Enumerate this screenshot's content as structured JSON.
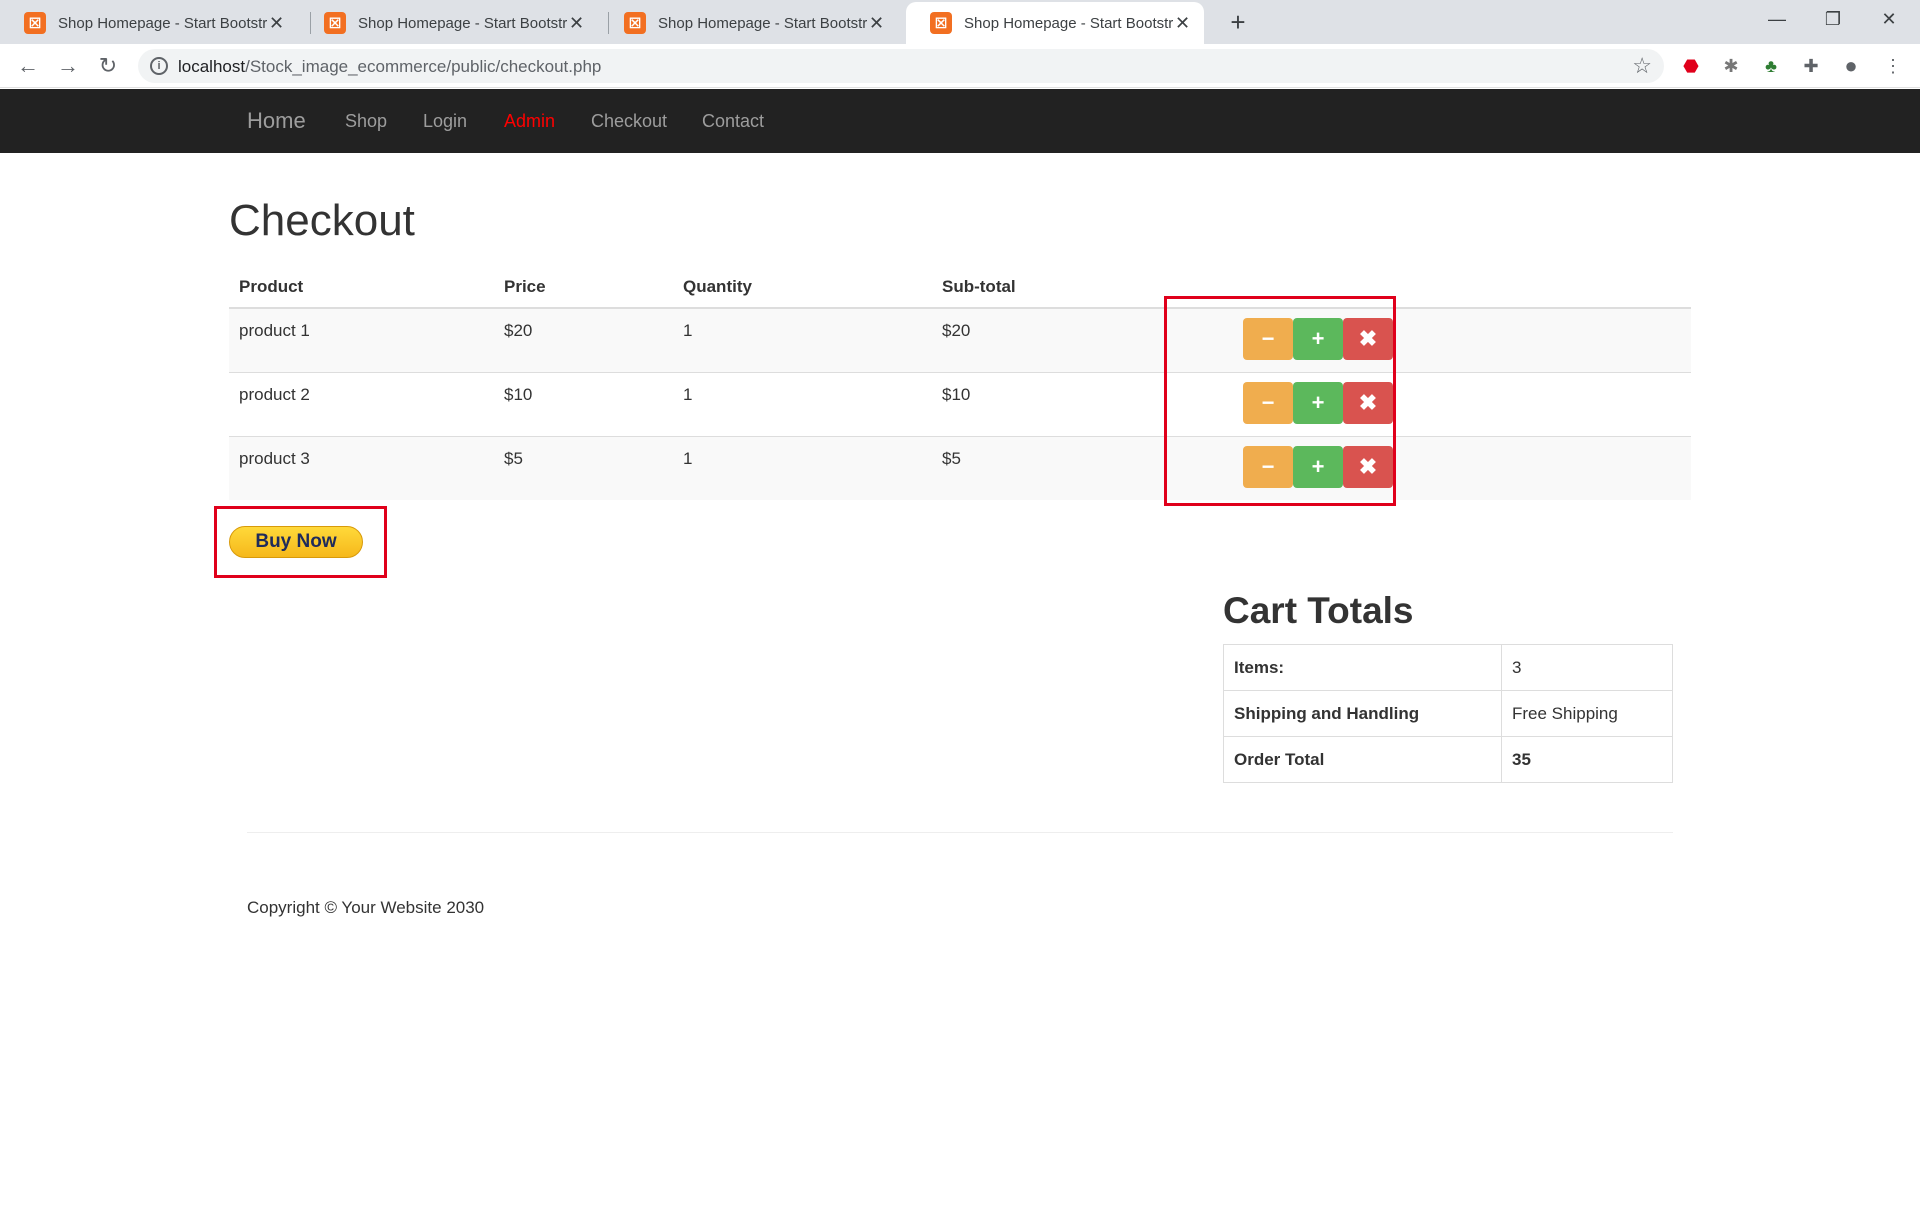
{
  "browser": {
    "tabs": [
      {
        "title": "Shop Homepage - Start Bootstrap",
        "active": false,
        "favicon": "xampp-icon"
      },
      {
        "title": "Shop Homepage - Start Bootstrap",
        "active": false,
        "favicon": "xampp-icon"
      },
      {
        "title": "Shop Homepage - Start Bootstrap",
        "active": false,
        "favicon": "xampp-icon"
      },
      {
        "title": "Shop Homepage - Start Bootstrap",
        "active": true,
        "favicon": "xampp-icon"
      }
    ],
    "url_host": "localhost",
    "url_path": "/Stock_image_ecommerce/public/checkout.php",
    "extensions": [
      "adblock-icon",
      "bug-icon",
      "tree-icon",
      "puzzle-icon",
      "profile-icon",
      "menu-icon"
    ]
  },
  "navbar": {
    "brand": "Home",
    "links": [
      "Shop",
      "Login",
      "Admin",
      "Checkout",
      "Contact"
    ],
    "admin_color": "#ff0000"
  },
  "checkout": {
    "title": "Checkout",
    "headers": [
      "Product",
      "Price",
      "Quantity",
      "Sub-total"
    ],
    "rows": [
      {
        "product": "product 1",
        "price": "$20",
        "quantity": "1",
        "subtotal": "$20"
      },
      {
        "product": "product 2",
        "price": "$10",
        "quantity": "1",
        "subtotal": "$10"
      },
      {
        "product": "product 3",
        "price": "$5",
        "quantity": "1",
        "subtotal": "$5"
      }
    ],
    "button_icons": {
      "minus": "minus-icon",
      "plus": "plus-icon",
      "remove": "remove-icon"
    },
    "buy_now": "Buy Now"
  },
  "totals": {
    "title": "Cart Totals",
    "items_label": "Items:",
    "items_value": "3",
    "shipping_label": "Shipping and Handling",
    "shipping_value": "Free Shipping",
    "order_label": "Order Total",
    "order_value": "35"
  },
  "footer": {
    "copyright": "Copyright © Your Website 2030"
  },
  "colors": {
    "navbar_bg": "#222222",
    "btn_minus": "#f0ad4e",
    "btn_plus": "#5cb85c",
    "btn_remove": "#d9534f",
    "highlight": "#e0001b"
  }
}
